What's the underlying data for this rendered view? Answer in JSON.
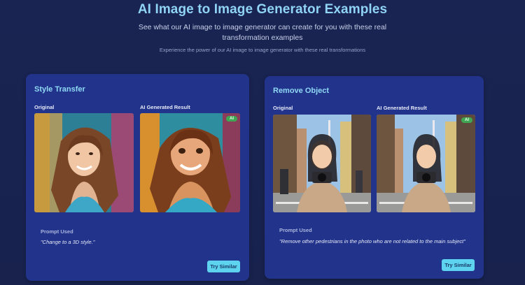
{
  "hero": {
    "title": "AI Image to Image Generator Examples",
    "subtitle": "See what our AI image to image generator can create for you with these real transformation examples",
    "note": "Experience the power of our AI image to image generator with these real transformations"
  },
  "examples": [
    {
      "title": "Style Transfer",
      "original_label": "Original",
      "result_label": "AI Generated Result",
      "badge": "AI",
      "prompt_heading": "Prompt Used",
      "prompt": "\"Change to a 3D style.\"",
      "button": "Try Similar"
    },
    {
      "title": "Remove Object",
      "original_label": "Original",
      "result_label": "AI Generated Result",
      "badge": "AI",
      "prompt_heading": "Prompt Used",
      "prompt": "\"Remove other pedestrians in the photo who are not related to the main subject\"",
      "button": "Try Similar"
    }
  ],
  "colors": {
    "background": "#1a2452",
    "card": "#22338c",
    "title_accent": "#8fd3f5",
    "button": "#5ed3ef",
    "badge": "#3fa653"
  }
}
